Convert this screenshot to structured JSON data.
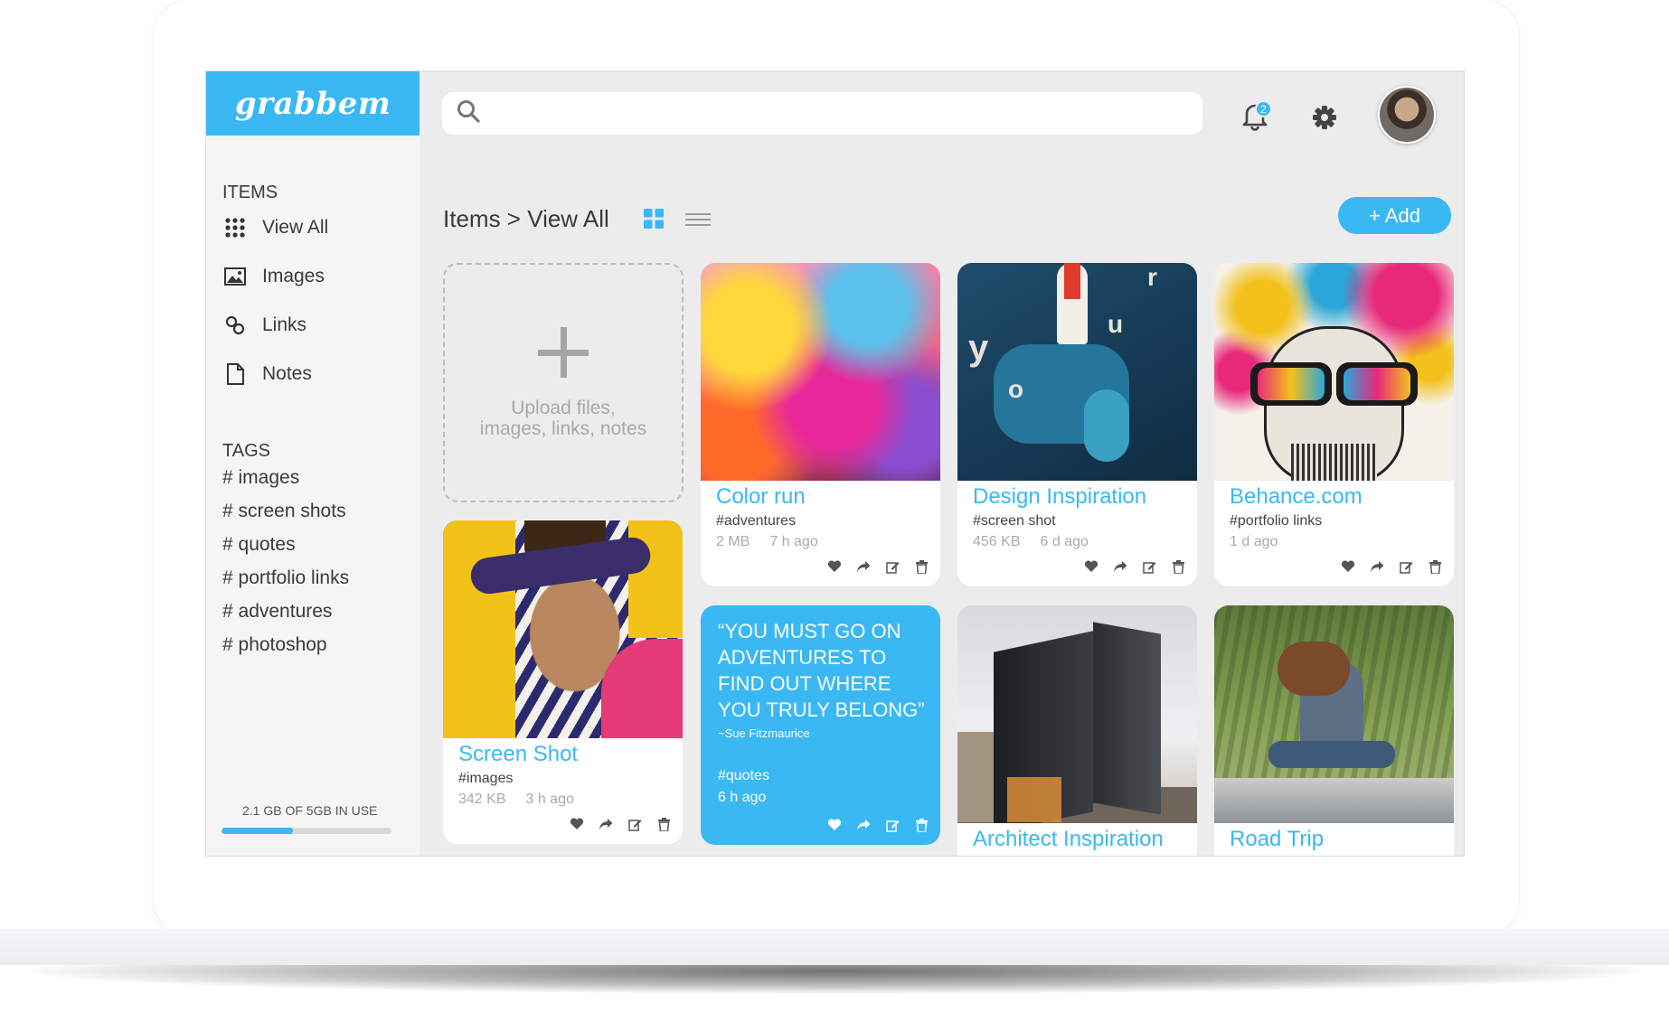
{
  "app": {
    "logo": "grabbem"
  },
  "sidebar": {
    "items_title": "ITEMS",
    "items": [
      {
        "label": "View All",
        "icon": "grid-dots-icon"
      },
      {
        "label": "Images",
        "icon": "image-icon"
      },
      {
        "label": "Links",
        "icon": "link-icon"
      },
      {
        "label": "Notes",
        "icon": "document-icon"
      }
    ],
    "tags_title": "TAGS",
    "tags": [
      "# images",
      "# screen shots",
      "# quotes",
      "# portfolio links",
      "# adventures",
      "# photoshop"
    ],
    "storage": {
      "label": "2.1 GB OF 5GB IN USE",
      "fraction": 0.42
    }
  },
  "header": {
    "search": {
      "placeholder": "",
      "value": ""
    },
    "notifications": {
      "count": "2",
      "icon": "bell-icon"
    },
    "settings_icon": "gear-icon",
    "avatar": "user-avatar"
  },
  "toolbar": {
    "breadcrumb": "Items > View All",
    "view_modes": [
      "grid-view-icon",
      "list-view-icon"
    ],
    "active_view": "grid",
    "add_label": "+ Add"
  },
  "upload": {
    "line1": "Upload files,",
    "line2": "images, links, notes"
  },
  "cards": {
    "screen_shot": {
      "title": "Screen Shot",
      "tag": "#images",
      "size": "342 KB",
      "time": "3 h ago"
    },
    "color_run": {
      "title": "Color run",
      "tag": "#adventures",
      "size": "2 MB",
      "time": "7 h ago"
    },
    "design": {
      "title": "Design Inspiration",
      "tag": "#screen shot",
      "size": "456 KB",
      "time": "6 d ago"
    },
    "behance": {
      "title": "Behance.com",
      "tag": "#portfolio links",
      "time": "1 d ago"
    },
    "quote": {
      "text": "“YOU MUST GO ON ADVENTURES TO FIND OUT WHERE YOU TRULY BELONG”",
      "author": "~Sue Fitzmaurice",
      "tag": "#quotes",
      "time": "6 h ago"
    },
    "architect": {
      "title": "Architect Inspiration"
    },
    "road_trip": {
      "title": "Road Trip"
    }
  },
  "colors": {
    "accent": "#39b8f3",
    "background": "#ececed",
    "sidebar": "#f5f5f6"
  },
  "card_action_icons": [
    "heart-icon",
    "share-icon",
    "edit-icon",
    "trash-icon"
  ]
}
